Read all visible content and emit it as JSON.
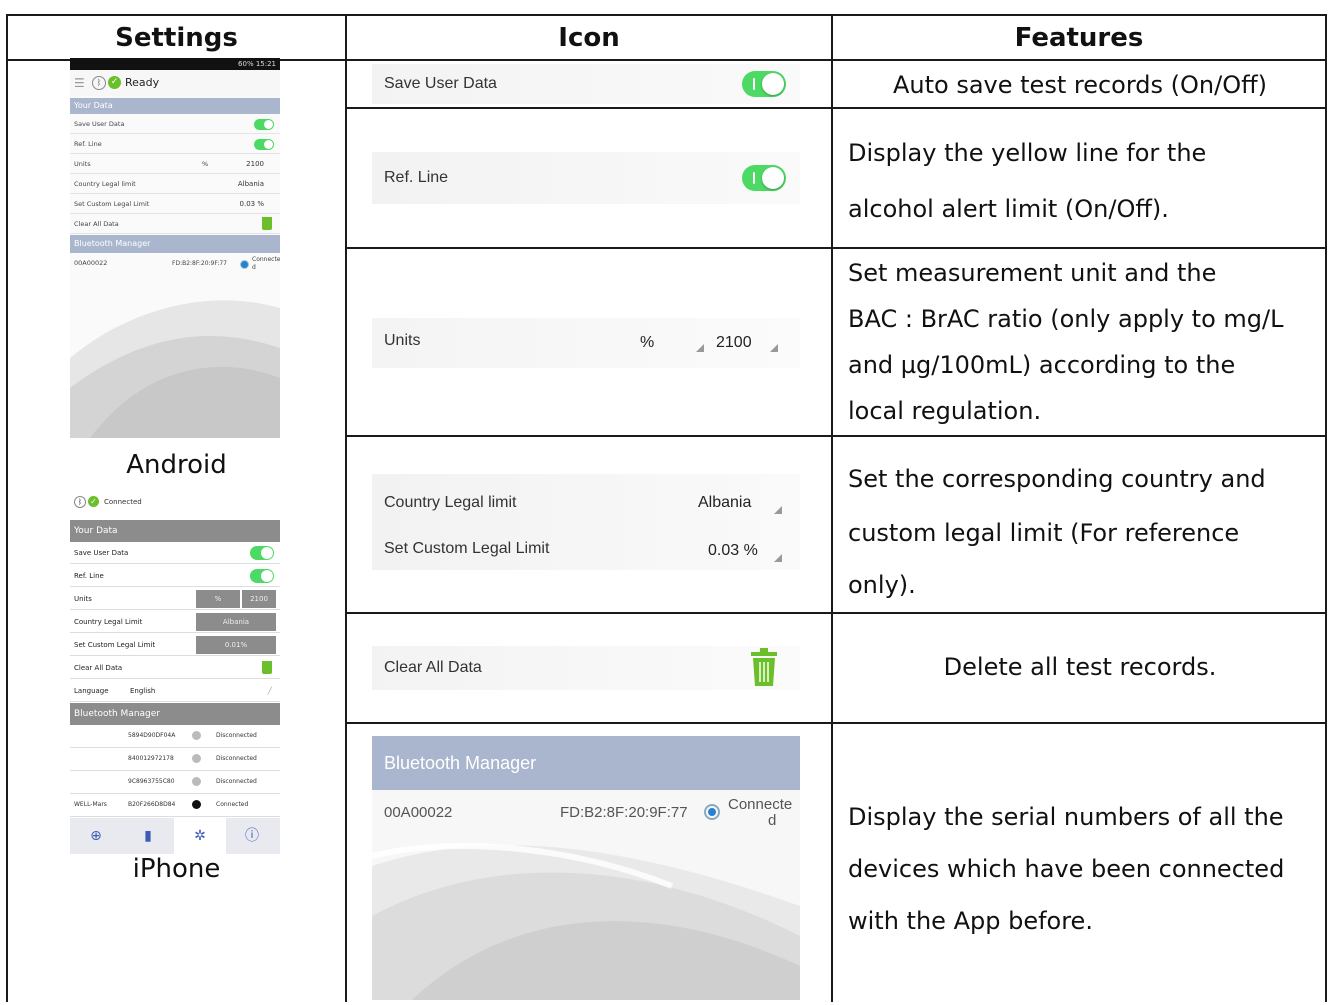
{
  "headers": {
    "settings": "Settings",
    "icon": "Icon",
    "features": "Features"
  },
  "captions": {
    "android": "Android",
    "iphone": "iPhone"
  },
  "android": {
    "status": "60%  15:21",
    "title": "Ready",
    "your_data": "Your Data",
    "rows": {
      "save": "Save User Data",
      "ref": "Ref. Line",
      "units": "Units",
      "units_val": "%",
      "ratio": "2100",
      "country": "Country Legal limit",
      "country_val": "Albania",
      "custom": "Set Custom Legal Limit",
      "custom_val": "0.03 %",
      "clear": "Clear All Data"
    },
    "bt": {
      "title": "Bluetooth Manager",
      "device": "00A00022",
      "mac": "FD:B2:8F:20:9F:77",
      "status": "Connecte d"
    }
  },
  "iphone": {
    "status": "Connected",
    "your_data": "Your Data",
    "save": "Save User Data",
    "ref": "Ref. Line",
    "units": "Units",
    "units_val": "%",
    "ratio": "2100",
    "country": "Country Legal Limit",
    "country_val": "Albania",
    "custom": "Set Custom Legal Limit",
    "custom_val": "0.01%",
    "clear": "Clear All Data",
    "language": "Language",
    "language_val": "English",
    "bt_title": "Bluetooth Manager",
    "devices": [
      {
        "name": "",
        "id": "5894D90DF04A",
        "status": "Disconnected"
      },
      {
        "name": "",
        "id": "840012972178",
        "status": "Disconnected"
      },
      {
        "name": "",
        "id": "9C8963755C80",
        "status": "Disconnected"
      },
      {
        "name": "WELL-Mars",
        "id": "B20F266D8D84",
        "status": "Connected"
      }
    ]
  },
  "icons": {
    "save": "Save User Data",
    "ref": "Ref. Line",
    "units": "Units",
    "units_val": "%",
    "ratio": "2100",
    "country": "Country Legal limit",
    "country_val": "Albania",
    "custom": "Set Custom Legal Limit",
    "custom_val": "0.03 %",
    "clear": "Clear All Data",
    "bt_title": "Bluetooth Manager",
    "bt_device": "00A00022",
    "bt_mac": "FD:B2:8F:20:9F:77",
    "bt_status_1": "Connecte",
    "bt_status_2": "d"
  },
  "features": {
    "f1": "Auto save test records (On/Off)",
    "f2a": "Display the yellow line for the",
    "f2b": "alcohol alert limit (On/Off).",
    "f3a": "Set measurement unit and the",
    "f3b": "BAC : BrAC ratio (only apply to mg/L",
    "f3c": "and µg/100mL) according to the",
    "f3d": "local regulation.",
    "f4a": "Set the corresponding country and",
    "f4b": "custom legal limit (For reference",
    "f4c": "only).",
    "f5": "Delete all test records.",
    "f6a": "Display the serial numbers of all the",
    "f6b": "devices which have been connected",
    "f6c": "with the App before."
  },
  "colors": {
    "toggle": "#4cd964",
    "bt_header": "#a9b6ce",
    "iphone_gray": "#8c8c8c",
    "trash": "#6abf2a"
  }
}
